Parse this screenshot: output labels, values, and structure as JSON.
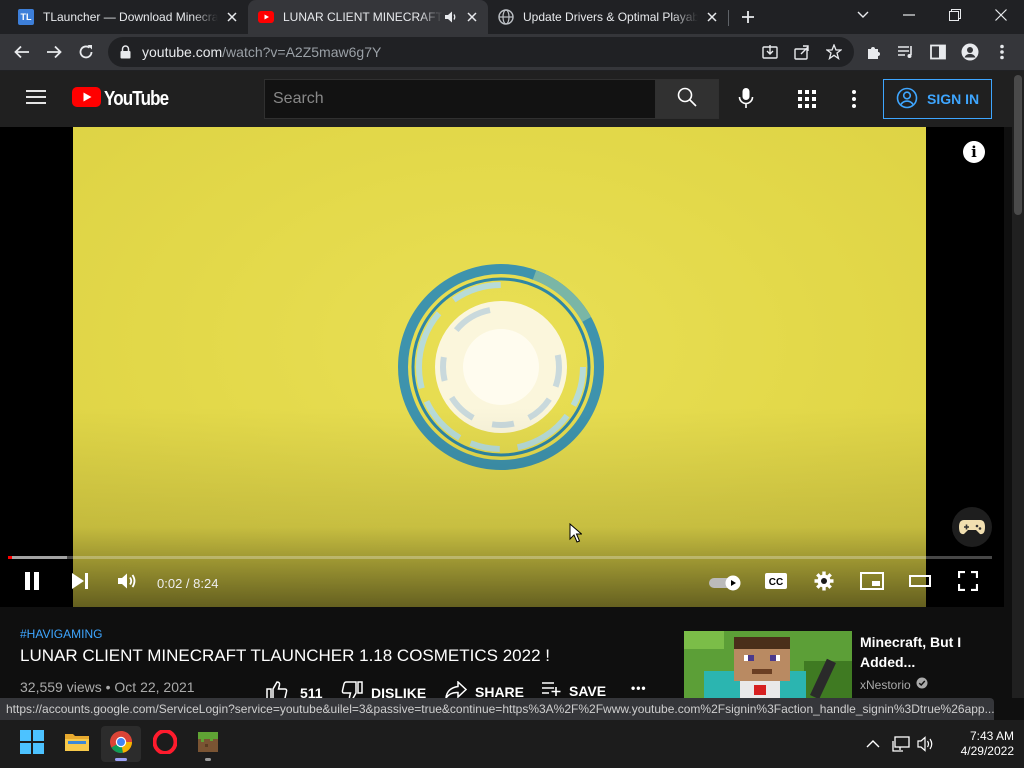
{
  "browser": {
    "tabs": [
      {
        "title": "TLauncher — Download Minecraft",
        "favicon": "TL",
        "favicon_color": "#3d7fd9",
        "active": false
      },
      {
        "title": "LUNAR CLIENT MINECRAFT TLAUNCHER",
        "favicon": "youtube-icon",
        "active": true,
        "audio": true
      },
      {
        "title": "Update Drivers & Optimal Playability",
        "favicon": "globe-icon",
        "active": false
      }
    ],
    "url_host": "youtube.com",
    "url_path": "/watch?v=A2Z5maw6g7Y"
  },
  "youtube": {
    "logo_text": "YouTube",
    "search_placeholder": "Search",
    "sign_in_label": "SIGN IN",
    "accent": "#3ea6ff"
  },
  "player": {
    "time": "0:02 / 8:24",
    "played_fraction": 0.004,
    "loaded_fraction": 0.06,
    "autoplay": true
  },
  "video": {
    "hashtag": "#HAVIGAMING",
    "title": "LUNAR CLIENT MINECRAFT TLAUNCHER 1.18 COSMETICS 2022 !",
    "meta": "32,559 views • Oct 22, 2021",
    "likes": "511",
    "dislike_label": "DISLIKE",
    "share_label": "SHARE",
    "save_label": "SAVE",
    "more_label": "•••"
  },
  "recommended": {
    "title": "Minecraft, But I Added...",
    "channel": "xNestorio"
  },
  "status_url": "https://accounts.google.com/ServiceLogin?service=youtube&uilel=3&passive=true&continue=https%3A%2F%2Fwww.youtube.com%2Fsignin%3Faction_handle_signin%3Dtrue%26app...",
  "taskbar": {
    "time": "7:43 AM",
    "date": "4/29/2022"
  }
}
